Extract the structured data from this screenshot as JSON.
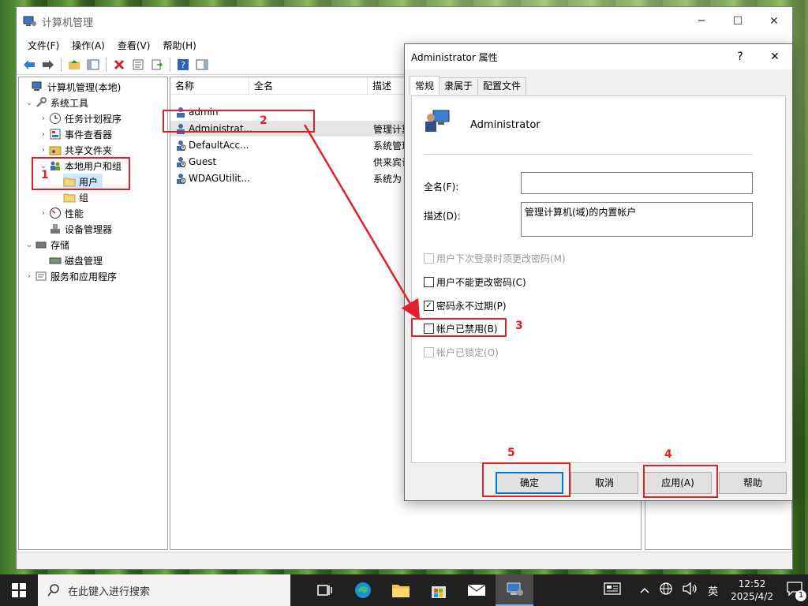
{
  "window": {
    "title": "计算机管理"
  },
  "menu": [
    "文件(F)",
    "操作(A)",
    "查看(V)",
    "帮助(H)"
  ],
  "tree": {
    "root": "计算机管理(本地)",
    "system_tools": "系统工具",
    "task_scheduler": "任务计划程序",
    "event_viewer": "事件查看器",
    "shared_folders": "共享文件夹",
    "local_users_groups": "本地用户和组",
    "users": "用户",
    "groups": "组",
    "performance": "性能",
    "device_manager": "设备管理器",
    "storage": "存储",
    "disk_management": "磁盘管理",
    "services_apps": "服务和应用程序"
  },
  "list": {
    "columns": [
      "名称",
      "全名",
      "描述"
    ],
    "rows": [
      {
        "name": "admin",
        "desc": ""
      },
      {
        "name": "Administrat...",
        "desc": "管理计算"
      },
      {
        "name": "DefaultAcc...",
        "desc": "系统管理"
      },
      {
        "name": "Guest",
        "desc": "供来宾访"
      },
      {
        "name": "WDAGUtilit...",
        "desc": "系统为"
      }
    ]
  },
  "dialog": {
    "title": "Administrator 属性",
    "help": "?",
    "close": "✕",
    "tabs": [
      "常规",
      "隶属于",
      "配置文件"
    ],
    "username": "Administrator",
    "fullname_label": "全名(F):",
    "fullname_value": "",
    "desc_label": "描述(D):",
    "desc_value": "管理计算机(域)的内置帐户",
    "checkboxes": [
      {
        "label": "用户下次登录时须更改密码(M)",
        "checked": false,
        "disabled": true
      },
      {
        "label": "用户不能更改密码(C)",
        "checked": false,
        "disabled": false
      },
      {
        "label": "密码永不过期(P)",
        "checked": true,
        "disabled": false
      },
      {
        "label": "帐户已禁用(B)",
        "checked": false,
        "disabled": false
      },
      {
        "label": "帐户已锁定(O)",
        "checked": false,
        "disabled": true
      }
    ],
    "buttons": {
      "ok": "确定",
      "cancel": "取消",
      "apply": "应用(A)",
      "help": "帮助"
    }
  },
  "annotations": [
    "1",
    "2",
    "3",
    "4",
    "5"
  ],
  "taskbar": {
    "search_placeholder": "在此键入进行搜索",
    "ime": "英",
    "time": "12:52",
    "date": "2025/4/2",
    "notif_count": "1"
  }
}
